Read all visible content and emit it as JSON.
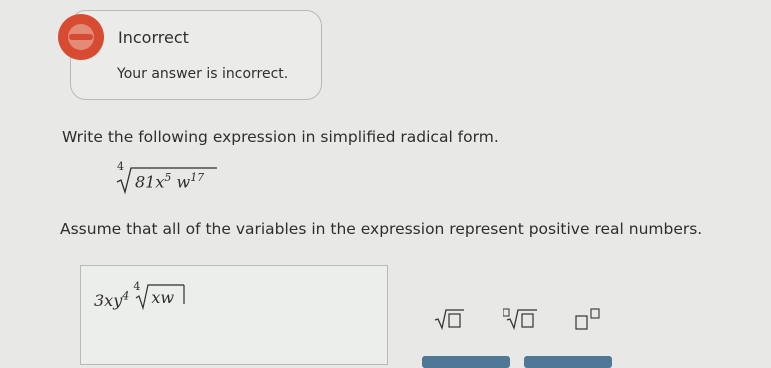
{
  "feedback": {
    "title": "Incorrect",
    "message": "Your answer is incorrect."
  },
  "question": {
    "prompt": "Write the following expression in simplified radical form.",
    "radical_index": "4",
    "radicand_base1": "81x",
    "radicand_exp1": "5",
    "radicand_base2": "w",
    "radicand_exp2": "17",
    "assumption": "Assume that all of the variables in the expression represent positive real numbers."
  },
  "answer": {
    "coefficient": "3xy",
    "exp_y": "4",
    "root_index": "4",
    "radicand": "xw"
  },
  "toolbar": {
    "icons": [
      "square-root-icon",
      "nth-root-icon",
      "superscript-icon"
    ]
  },
  "colors": {
    "error": "#d84b33",
    "button": "#4f7896"
  }
}
